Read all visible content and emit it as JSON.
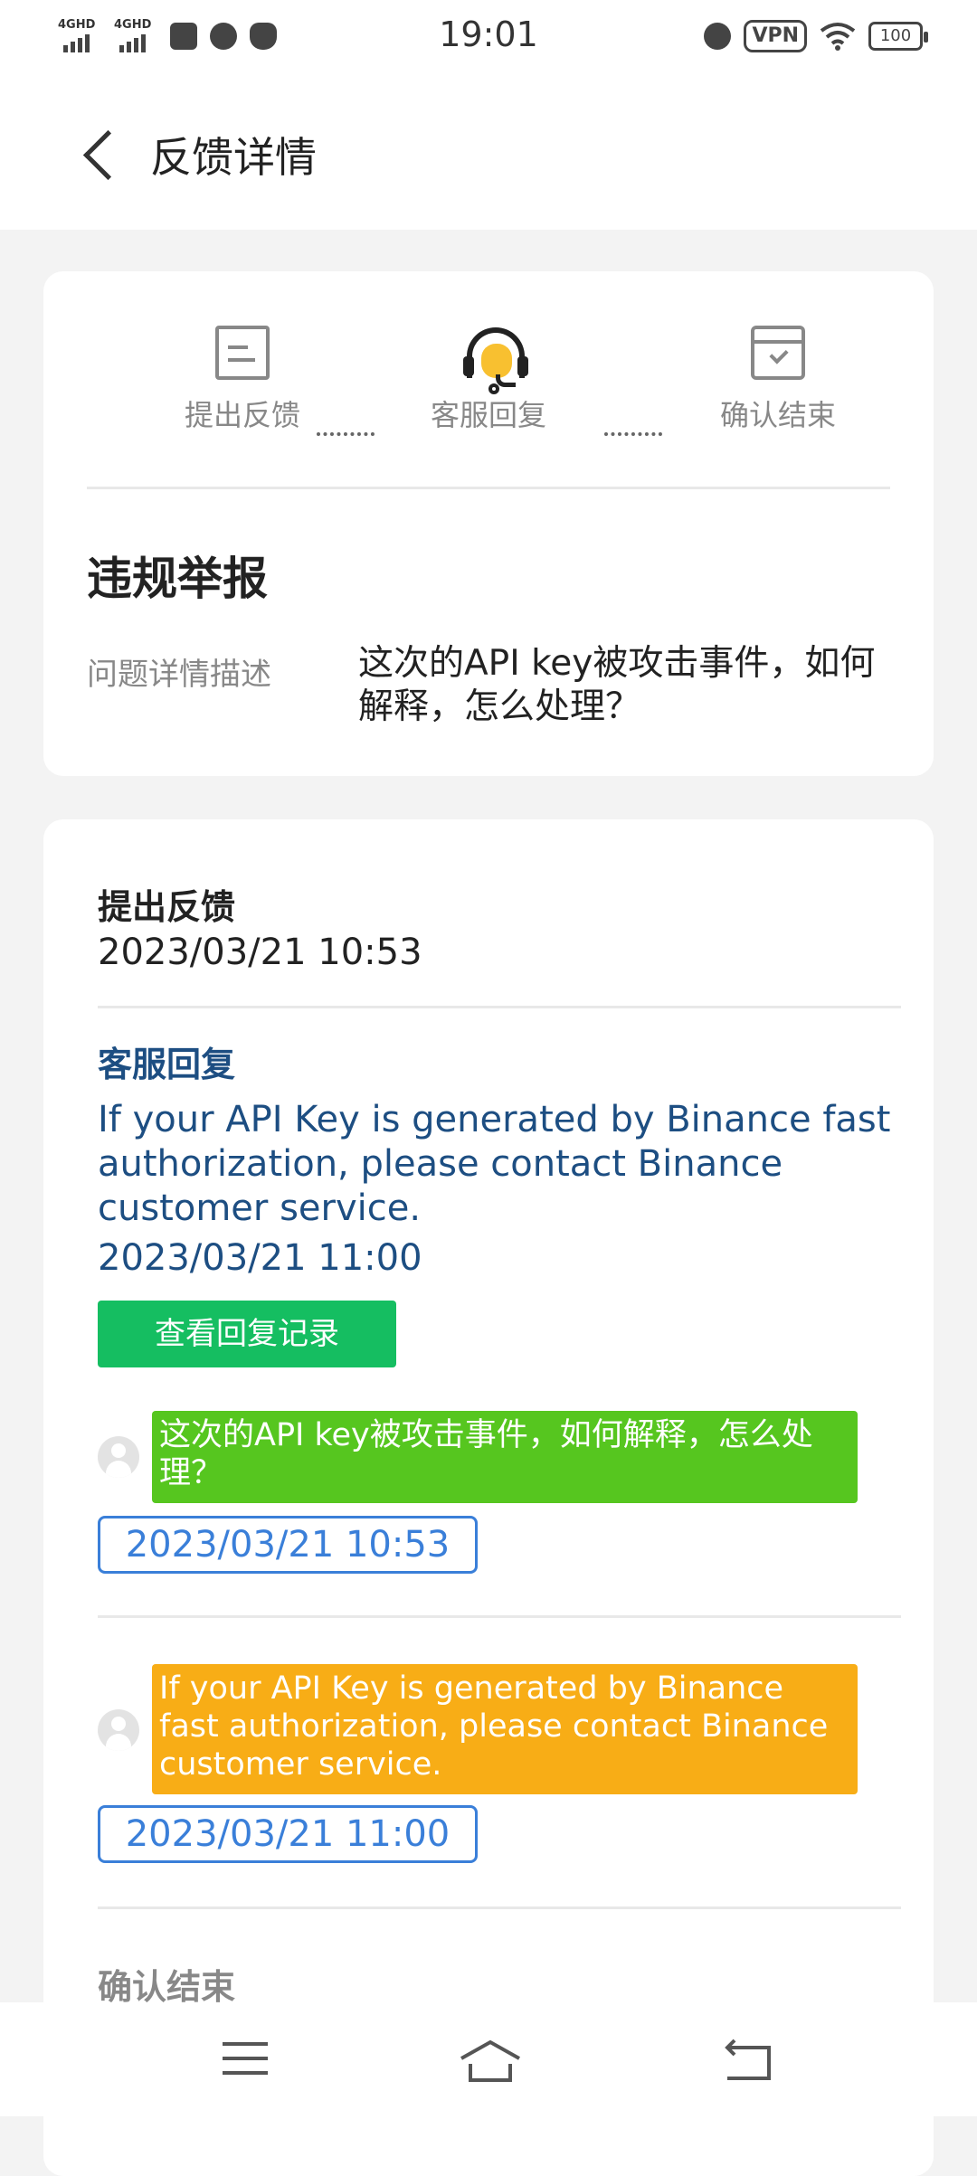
{
  "status_bar": {
    "time": "19:01",
    "network_1": "4GHD",
    "network_2": "4GHD",
    "vpn": "VPN",
    "battery": "100",
    "icons": [
      "clipboard-check-icon",
      "flame-icon",
      "shield-x-icon",
      "alarm-icon",
      "wifi-icon"
    ]
  },
  "header": {
    "title": "反馈详情"
  },
  "progress": {
    "steps": [
      {
        "label": "提出反馈",
        "icon": "edit-note-icon"
      },
      {
        "label": "客服回复",
        "icon": "headset-icon"
      },
      {
        "label": "确认结束",
        "icon": "calendar-check-icon"
      }
    ],
    "current_step": 2
  },
  "issue": {
    "type": "违规举报",
    "description_label": "问题详情描述",
    "description": "这次的API key被攻击事件，如何解释，怎么处理？"
  },
  "timeline": {
    "submit": {
      "title": "提出反馈",
      "time": "2023/03/21 10:53"
    },
    "reply": {
      "title": "客服回复",
      "text": "If your API Key is generated by Binance fast authorization, please contact Binance customer service.",
      "time": "2023/03/21 11:00",
      "view_button": "查看回复记录"
    },
    "messages": [
      {
        "text": "这次的API key被攻击事件，如何解释，怎么处理？",
        "time": "2023/03/21 10:53",
        "color": "#56c61f"
      },
      {
        "text": "If your API Key is generated by Binance fast authorization, please contact Binance customer service.",
        "time": "2023/03/21 11:00",
        "color": "#f8ad16"
      }
    ],
    "confirm": {
      "title": "确认结束"
    }
  },
  "nav_bar": {
    "icons": [
      "menu-icon",
      "home-icon",
      "back-icon"
    ]
  },
  "colors": {
    "accent_blue": "#1d4e82",
    "button_green": "#15be61",
    "time_box_blue": "#3a7fd9"
  }
}
